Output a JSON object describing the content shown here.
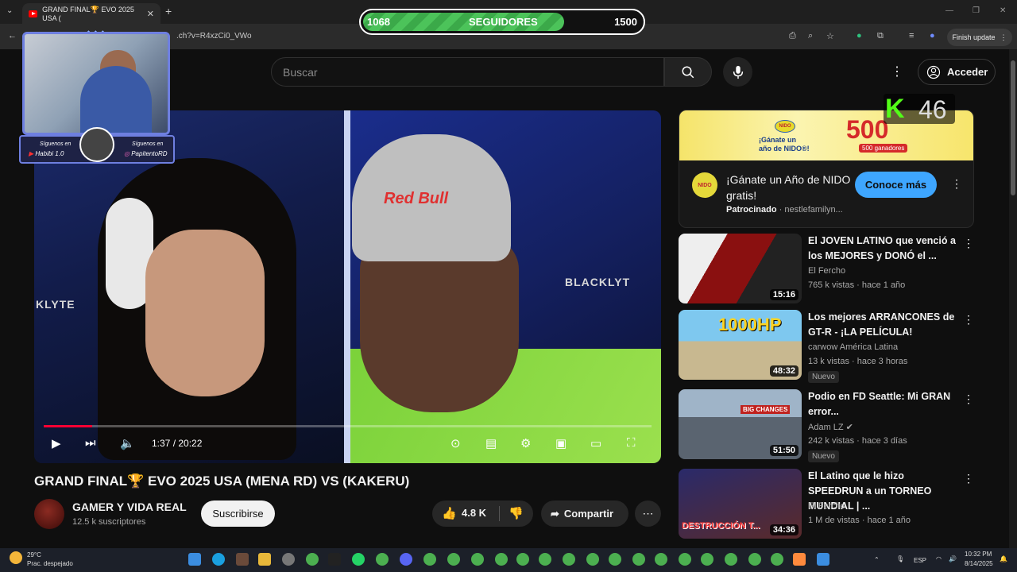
{
  "browser": {
    "tab_title": "GRAND FINAL🏆 EVO 2025 USA (",
    "tab_close": "✕",
    "new_tab": "+",
    "url": ".ch?v=R4xzCi0_VWo",
    "finish_update": "Finish update"
  },
  "follower_goal": {
    "current": "1068",
    "label": "SEGUIDORES",
    "goal": "1500",
    "progress": 0.71,
    "color": "#4cc35a"
  },
  "header": {
    "search_placeholder": "Buscar",
    "acceder": "Acceder"
  },
  "webcam": {
    "left_caption": "Síguenos en",
    "left_handle": "Habibi 1.0",
    "right_caption": "Síguenos en",
    "right_handle": "PapitentoRD"
  },
  "video": {
    "chair_left": "KLYTE",
    "chair_right": "BLACKLYT",
    "logo": "Red Bull",
    "time": "1:37 / 20:22",
    "played_fraction": 0.08
  },
  "main": {
    "title": "GRAND FINAL🏆 EVO 2025 USA (MENA RD) VS (KAKERU)",
    "channel": "GAMER Y VIDA REAL",
    "subscribers": "12.5 k suscriptores",
    "subscribe": "Suscribirse",
    "likes": "4.8 K",
    "share": "Compartir"
  },
  "ad": {
    "banner_brand": "NIDO",
    "banner_text_1": "¡Gánate un",
    "banner_text_2": "año de NIDO®!",
    "banner_big": "500",
    "banner_winners": "500 ganadores",
    "logo": "NIDO",
    "title": "¡Gánate un Año de NIDO gratis!",
    "sponsored": "Patrocinado",
    "advertiser": "· nestlefamilyn...",
    "cta": "Conoce más"
  },
  "kick_overlay": {
    "logo": "K",
    "count": "46"
  },
  "recommendations": [
    {
      "title": "El JOVEN LATINO que venció a los MEJORES y DONÓ el ...",
      "channel": "El Fercho",
      "meta": "765 k vistas · hace 1 año",
      "duration": "15:16",
      "badge": ""
    },
    {
      "title": "Los mejores ARRANCONES de GT-R - ¡LA PELÍCULA!",
      "channel": "carwow América Latina",
      "meta": "13 k vistas · hace 3 horas",
      "duration": "48:32",
      "badge": "Nuevo",
      "thumb_text": "1000HP"
    },
    {
      "title": "Podio en FD Seattle: Mi GRAN error...",
      "channel": "Adam LZ ✔",
      "meta": "242 k vistas · hace 3 días",
      "duration": "51:50",
      "badge": "Nuevo",
      "thumb_text": "BIG CHANGES"
    },
    {
      "title": "El Latino que le hizo SPEEDRUN a un TORNEO MUNDIAL | ...",
      "channel": "El Fercho",
      "meta": "1 M de vistas · hace 1 año",
      "duration": "34:36",
      "badge": "",
      "thumb_text": "DESTRUCCIÓN T..."
    }
  ],
  "taskbar": {
    "temperature": "29°C",
    "weather": "Prac. despejado",
    "language": "ESP",
    "time": "10:32 PM",
    "date": "8/14/2025"
  }
}
